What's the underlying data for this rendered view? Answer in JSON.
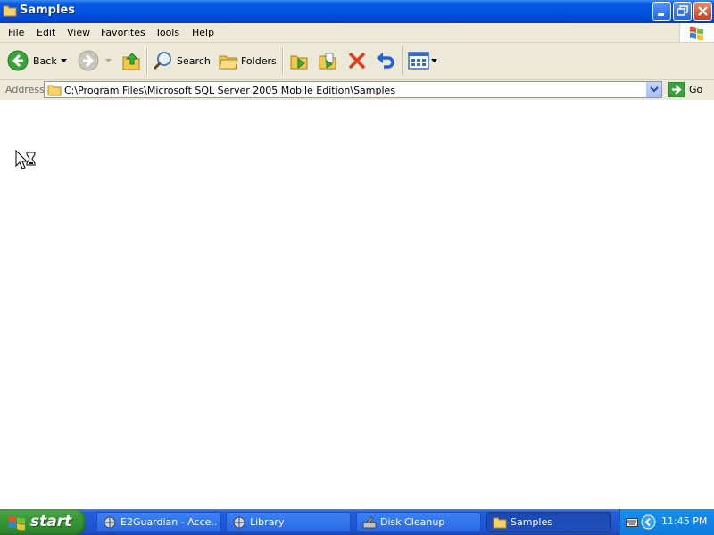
{
  "window": {
    "title": "Samples"
  },
  "menu": {
    "items": [
      "File",
      "Edit",
      "View",
      "Favorites",
      "Tools",
      "Help"
    ]
  },
  "toolbar": {
    "back_label": "Back",
    "search_label": "Search",
    "folders_label": "Folders"
  },
  "address": {
    "label": "Address",
    "path": "C:\\Program Files\\Microsoft SQL Server 2005 Mobile Edition\\Samples",
    "go_label": "Go"
  },
  "taskbar": {
    "start_label": "start",
    "tasks": [
      {
        "label": "E2Guardian - Acce...",
        "icon": "web-icon",
        "active": false
      },
      {
        "label": "Library",
        "icon": "web-icon",
        "active": false
      },
      {
        "label": "Disk Cleanup",
        "icon": "disk-cleanup-icon",
        "active": false
      },
      {
        "label": "Samples",
        "icon": "folder-icon",
        "active": true
      }
    ],
    "clock": "11:45 PM"
  },
  "colors": {
    "titlebar": "#0054e3",
    "taskbar": "#245edb",
    "start": "#3c9c3a",
    "tray": "#0f7bdc",
    "chrome": "#ece9d8"
  }
}
